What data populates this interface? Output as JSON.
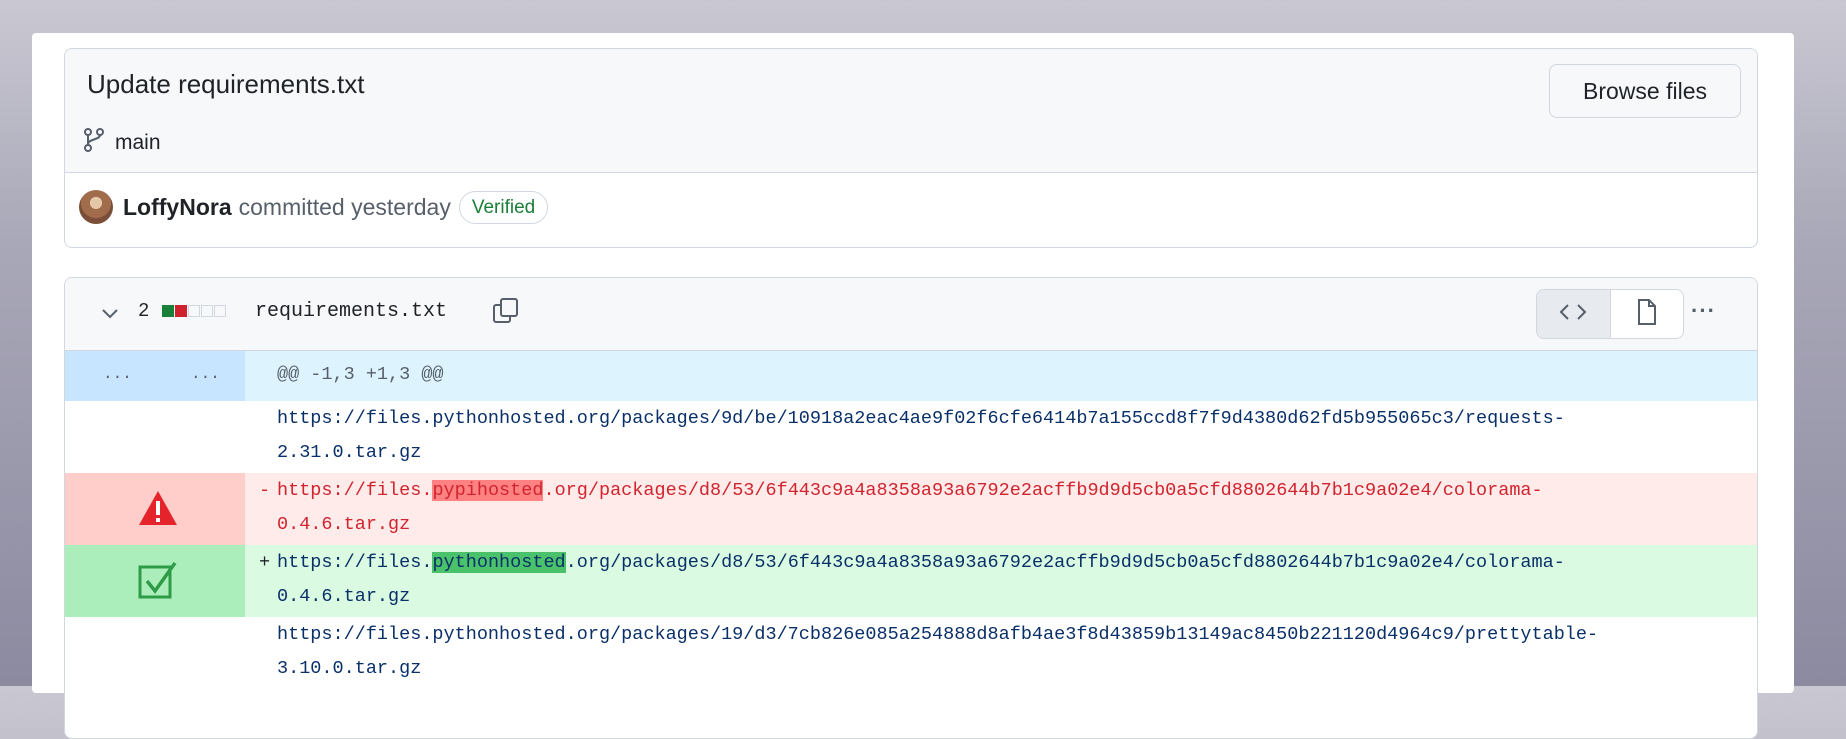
{
  "commit": {
    "title": "Update requirements.txt",
    "browse_files_label": "Browse files",
    "branch": "main",
    "author": "LoffyNora",
    "action": "committed yesterday",
    "verified_badge": "Verified"
  },
  "file": {
    "changes_count": "2",
    "name": "requirements.txt",
    "diffstat": [
      "added",
      "deleted",
      "neutral",
      "neutral",
      "neutral"
    ]
  },
  "diff": {
    "hunk_gutter_old": "...",
    "hunk_gutter_new": "...",
    "hunk_header": "@@ -1,3 +1,3 @@",
    "context_1": {
      "line1": "https://files.pythonhosted.org/packages/9d/be/10918a2eac4ae9f02f6cfe6414b7a155ccd8f7f9d4380d62fd5b955065c3/requests-",
      "line2": "2.31.0.tar.gz"
    },
    "deleted": {
      "sign": "-",
      "prefix": "https://files.",
      "highlight": "pypihosted",
      "suffix": ".org/packages/d8/53/6f443c9a4a8358a93a6792e2acffb9d9d5cb0a5cfd8802644b7b1c9a02e4/colorama-",
      "line2": "0.4.6.tar.gz",
      "gutter_icon": "warning-icon"
    },
    "added": {
      "sign": "+",
      "prefix": "https://files.",
      "highlight": "pythonhosted",
      "suffix": ".org/packages/d8/53/6f443c9a4a8358a93a6792e2acffb9d9d5cb0a5cfd8802644b7b1c9a02e4/colorama-",
      "line2": "0.4.6.tar.gz",
      "gutter_icon": "check-icon"
    },
    "context_2": {
      "line1": "https://files.pythonhosted.org/packages/19/d3/7cb826e085a254888d8afb4ae3f8d43859b13149ac8450b221120d4964c9/prettytable-",
      "line2": "3.10.0.tar.gz"
    }
  },
  "colors": {
    "added_bg": "#dafbe1",
    "deleted_bg": "#ffebe9",
    "hunk_bg": "#ddf4ff",
    "warning_red": "#e5232b",
    "check_green": "#2e9c47"
  }
}
